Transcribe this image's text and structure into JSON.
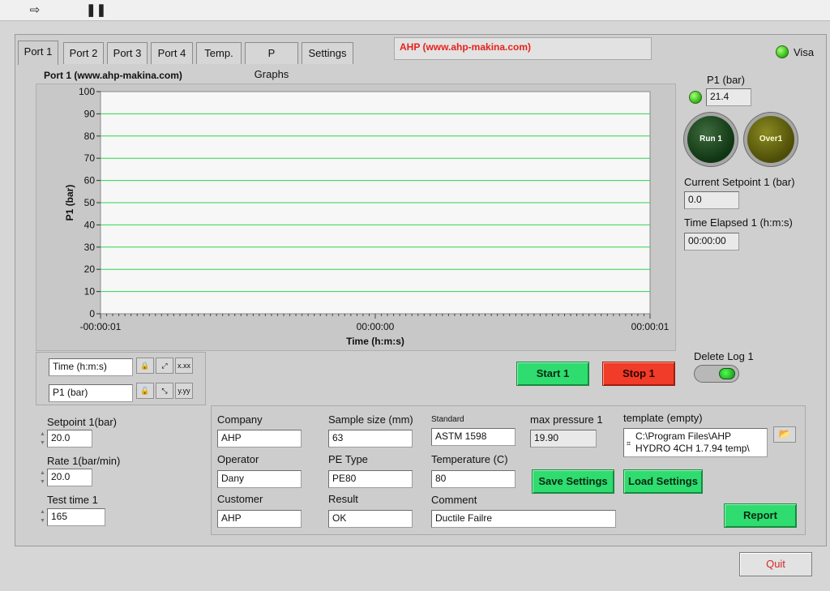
{
  "toolbar": {
    "run_icon": "arrow-right-icon",
    "pause_icon": "pause-icon"
  },
  "tabs": [
    {
      "label": "Port 1"
    },
    {
      "label": "Port 2"
    },
    {
      "label": "Port 3"
    },
    {
      "label": "Port 4"
    },
    {
      "label": "Temp."
    },
    {
      "label": "P Graphs"
    },
    {
      "label": "Settings"
    }
  ],
  "header_text": "AHP (www.ahp-makina.com)",
  "visa_label": "Visa",
  "chart_title": "Port 1 (www.ahp-makina.com)",
  "chart_data": {
    "type": "line",
    "title": "Port 1 (www.ahp-makina.com)",
    "xlabel": "Time (h:m:s)",
    "ylabel": "P1 (bar)",
    "ylim": [
      0,
      100
    ],
    "y_ticks": [
      "100",
      "90",
      "80",
      "70",
      "60",
      "50",
      "40",
      "30",
      "20",
      "10",
      "0"
    ],
    "x_ticks": [
      "-00:00:01",
      "00:00:00",
      "00:00:01"
    ],
    "grid": true,
    "series": []
  },
  "legend": {
    "x_name": "Time (h:m:s)",
    "y_name": "P1 (bar)"
  },
  "right_panel": {
    "p1_label": "P1 (bar)",
    "p1_value": "21.4",
    "run_label": "Run 1",
    "over_label": "Over1",
    "setpoint_label": "Current Setpoint 1 (bar)",
    "setpoint_value": "0.0",
    "elapsed_label": "Time Elapsed 1 (h:m:s)",
    "elapsed_value": "00:00:00",
    "delete_log_label": "Delete Log 1"
  },
  "controls": {
    "start_label": "Start 1",
    "stop_label": "Stop 1",
    "setpoint_label": "Setpoint 1(bar)",
    "setpoint_value": "20.0",
    "rate_label": "Rate 1(bar/min)",
    "rate_value": "20.0",
    "testtime_label": "Test time 1",
    "testtime_value": "165"
  },
  "form": {
    "company_label": "Company",
    "company_value": "AHP",
    "operator_label": "Operator",
    "operator_value": "Dany",
    "customer_label": "Customer",
    "customer_value": "AHP",
    "sample_label": "Sample size (mm)",
    "sample_value": "63",
    "petype_label": "PE Type",
    "petype_value": "PE80",
    "result_label": "Result",
    "result_value": "OK",
    "standard_label": "Standard",
    "standard_value": "ASTM 1598",
    "temperature_label": "Temperature (C)",
    "temperature_value": "80",
    "comment_label": "Comment",
    "comment_value": "Ductile Failre",
    "maxpressure_label": "max pressure 1",
    "maxpressure_value": "19.90",
    "template_label": "template (empty)",
    "template_value_line1": "C:\\Program Files\\AHP",
    "template_value_line2": "HYDRO 4CH 1.7.94 temp\\",
    "save_label": "Save Settings",
    "load_label": "Load Settings",
    "report_label": "Report"
  },
  "quit_label": "Quit"
}
